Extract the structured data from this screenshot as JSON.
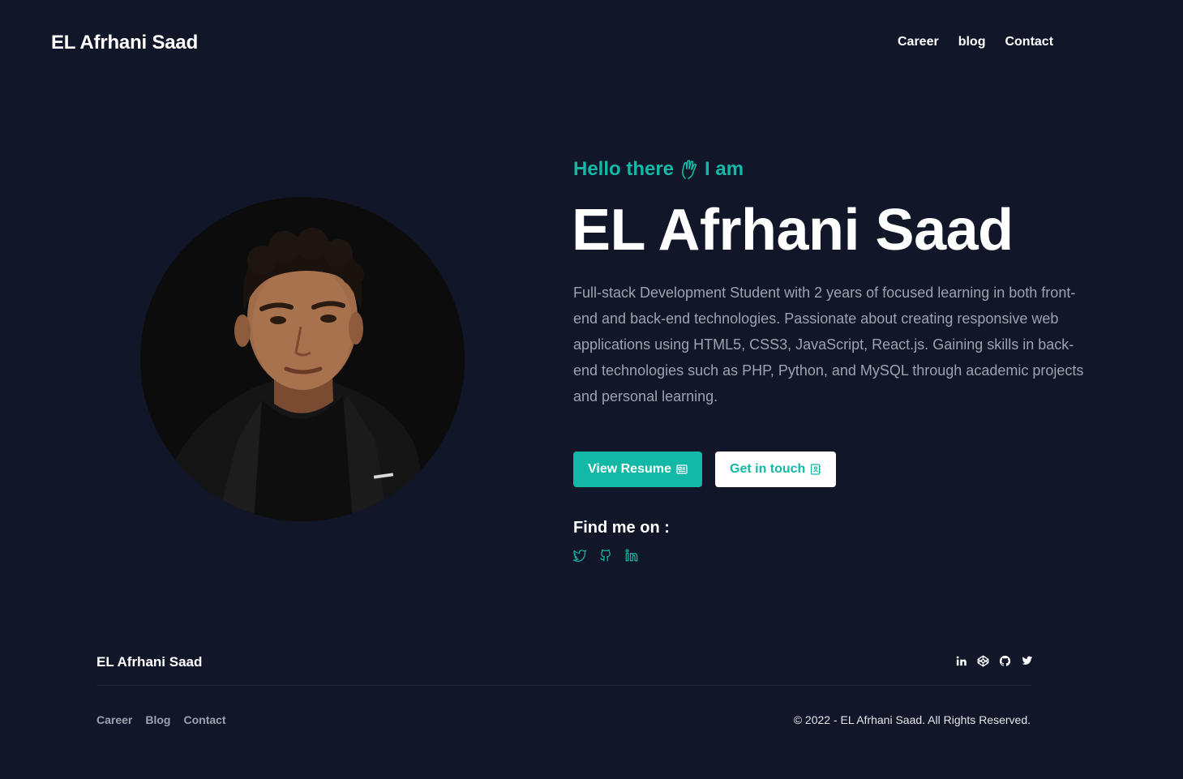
{
  "header": {
    "brand": "EL Afrhani Saad",
    "nav": [
      {
        "label": "Career"
      },
      {
        "label": "blog"
      },
      {
        "label": "Contact"
      }
    ]
  },
  "hero": {
    "greeting_part1": "Hello there",
    "greeting_icon": "waving-hand-icon",
    "greeting_part2": "I am",
    "name": "EL Afrhani Saad",
    "bio": "Full-stack Development Student with 2 years of focused learning in both front-end and back-end technologies. Passionate about creating responsive web applications using HTML5, CSS3, JavaScript, React.js. Gaining skills in back-end technologies such as PHP, Python, and MySQL through academic projects and personal learning.",
    "buttons": {
      "resume_label": "View Resume",
      "resume_icon": "resume-icon",
      "contact_label": "Get in touch",
      "contact_icon": "contact-book-icon"
    },
    "find_me_title": "Find me on :",
    "socials": [
      "twitter-icon",
      "github-icon",
      "linkedin-icon"
    ]
  },
  "footer": {
    "brand": "EL Afrhani Saad",
    "icons": [
      "linkedin-icon",
      "codepen-icon",
      "github-icon",
      "twitter-icon"
    ],
    "nav": [
      {
        "label": "Career"
      },
      {
        "label": "Blog"
      },
      {
        "label": "Contact"
      }
    ],
    "copyright": "© 2022 - EL Afrhani Saad. All Rights Reserved."
  },
  "colors": {
    "background": "#111629",
    "accent": "#14b8a6",
    "text": "#ffffff",
    "muted": "#9ca3af"
  }
}
